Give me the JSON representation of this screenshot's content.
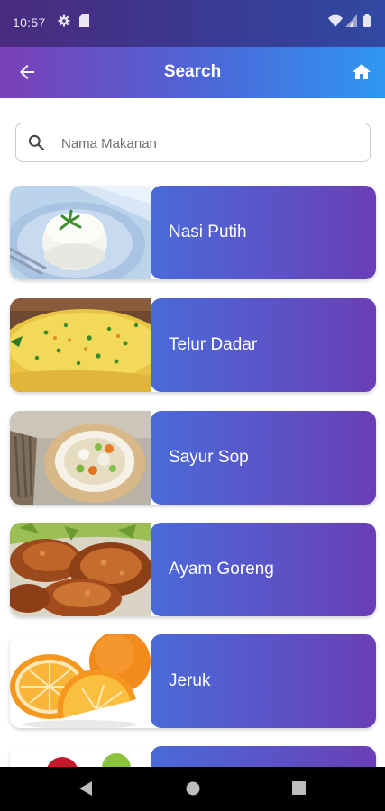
{
  "status": {
    "time": "10:57"
  },
  "app_bar": {
    "title": "Search"
  },
  "search": {
    "placeholder": "Nama Makanan",
    "value": ""
  },
  "foods": [
    {
      "name": "Nasi Putih",
      "image": "white-rice"
    },
    {
      "name": "Telur Dadar",
      "image": "omelette"
    },
    {
      "name": "Sayur Sop",
      "image": "vegetable-soup"
    },
    {
      "name": "Ayam Goreng",
      "image": "fried-chicken"
    },
    {
      "name": "Jeruk",
      "image": "oranges"
    },
    {
      "name": "",
      "image": "fruits-partial"
    }
  ],
  "colors": {
    "accent_start": "#7b3fb6",
    "accent_end": "#2f97f0",
    "card_start": "#4a6ad8",
    "card_end": "#6a3eb6"
  }
}
